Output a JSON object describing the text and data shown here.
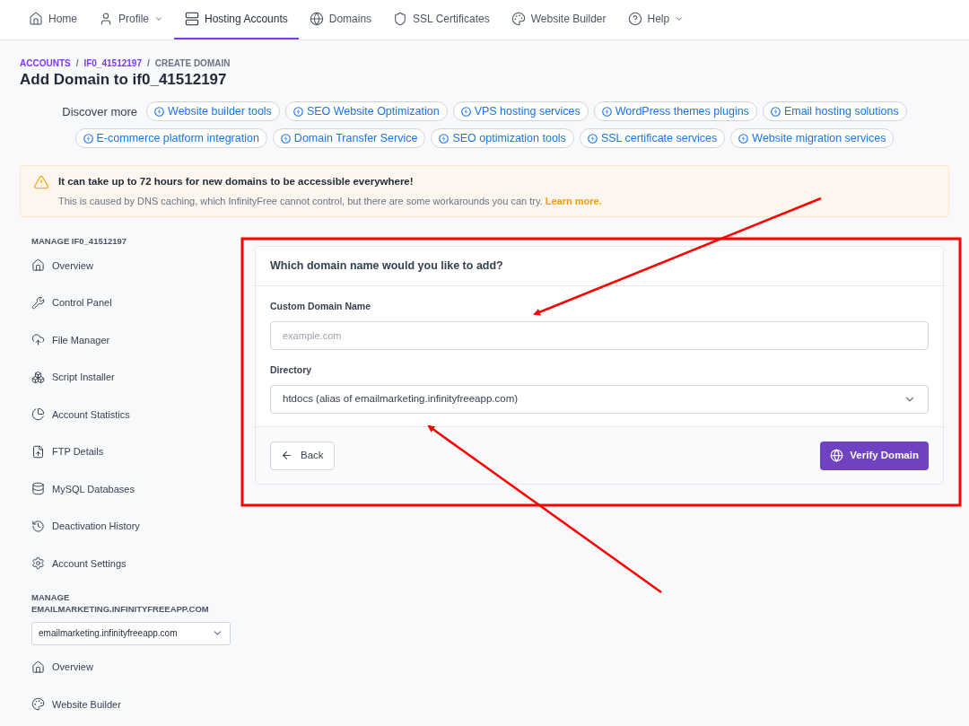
{
  "nav": {
    "items": [
      {
        "label": "Home",
        "selected": false,
        "dropdown": false
      },
      {
        "label": "Profile",
        "selected": false,
        "dropdown": true
      },
      {
        "label": "Hosting Accounts",
        "selected": true,
        "dropdown": false
      },
      {
        "label": "Domains",
        "selected": false,
        "dropdown": false
      },
      {
        "label": "SSL Certificates",
        "selected": false,
        "dropdown": false
      },
      {
        "label": "Website Builder",
        "selected": false,
        "dropdown": false
      },
      {
        "label": "Help",
        "selected": false,
        "dropdown": true
      }
    ]
  },
  "breadcrumb": [
    {
      "label": "ACCOUNTS",
      "link": true
    },
    {
      "label": "IF0_41512197",
      "link": true
    },
    {
      "label": "CREATE DOMAIN",
      "link": false
    }
  ],
  "separator": "/",
  "title": "Add Domain to if0_41512197",
  "discover": {
    "label": "Discover more",
    "rows": [
      [
        "Website builder tools",
        "SEO Website Optimization",
        "VPS hosting services",
        "WordPress themes plugins",
        "Email hosting solutions"
      ],
      [
        "E-commerce platform integration",
        "Domain Transfer Service",
        "SEO optimization tools",
        "SSL certificate services",
        "Website migration services"
      ]
    ]
  },
  "alert": {
    "title": "It can take up to 72 hours for new domains to be accessible everywhere!",
    "text": "This is caused by DNS caching, which InfinityFree cannot control, but there are some workarounds you can try.",
    "link": "Learn more."
  },
  "sidebar": {
    "sections": [
      {
        "heading": "MANAGE IF0_41512197",
        "items": [
          "Overview",
          "Control Panel",
          "File Manager",
          "Script Installer",
          "Account Statistics",
          "FTP Details",
          "MySQL Databases",
          "Deactivation History",
          "Account Settings"
        ]
      },
      {
        "heading": "MANAGE EMAILMARKETING.INFINITYFREEAPP.COM",
        "select": "emailmarketing.infinityfreeapp.com",
        "items": [
          "Overview",
          "Website Builder"
        ]
      }
    ]
  },
  "form": {
    "heading": "Which domain name would you like to add?",
    "domain_label": "Custom Domain Name",
    "domain_placeholder": "example.com",
    "directory_label": "Directory",
    "directory_value": "htdocs (alias of emailmarketing.infinityfreeapp.com)",
    "back": "Back",
    "submit": "Verify Domain"
  }
}
